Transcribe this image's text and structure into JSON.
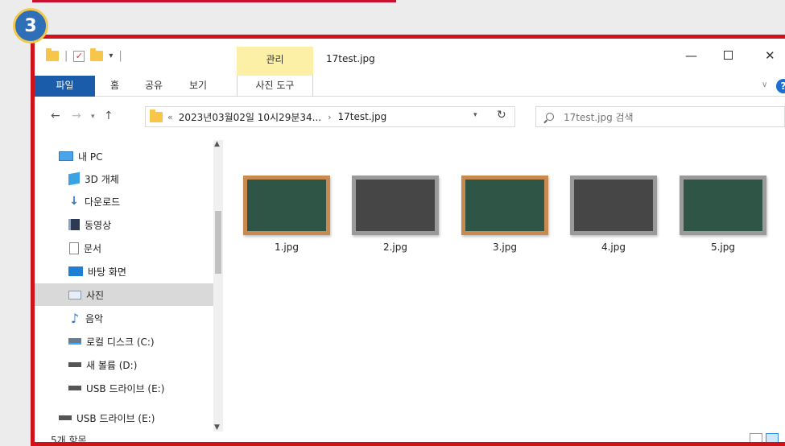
{
  "step_badge": "3",
  "window": {
    "title": "17test.jpg",
    "manage_tab": "관리"
  },
  "ribbon": {
    "tabs": [
      "파일",
      "홈",
      "공유",
      "보기",
      "사진 도구"
    ]
  },
  "address": {
    "overflow": "«",
    "crumbs": [
      "2023년03월02일 10시29분34...",
      "17test.jpg"
    ],
    "arrow": "›",
    "search_placeholder": "17test.jpg 검색"
  },
  "nav_pane": {
    "items": [
      {
        "label": "내 PC",
        "icon": "pc-icon"
      },
      {
        "label": "3D 개체",
        "icon": "3d-objects-icon"
      },
      {
        "label": "다운로드",
        "icon": "download-icon"
      },
      {
        "label": "동영상",
        "icon": "video-icon"
      },
      {
        "label": "문서",
        "icon": "document-icon"
      },
      {
        "label": "바탕 화면",
        "icon": "desktop-icon"
      },
      {
        "label": "사진",
        "icon": "pictures-icon",
        "selected": true
      },
      {
        "label": "음악",
        "icon": "music-icon"
      },
      {
        "label": "로컬 디스크 (C:)",
        "icon": "local-disk-icon"
      },
      {
        "label": "새 볼륨 (D:)",
        "icon": "drive-icon"
      },
      {
        "label": "USB 드라이브 (E:)",
        "icon": "usb-drive-icon"
      },
      {
        "label": "USB 드라이브 (E:)",
        "icon": "usb-drive-icon"
      }
    ]
  },
  "files": [
    {
      "name": "1.jpg",
      "frame": "wood",
      "board": "green"
    },
    {
      "name": "2.jpg",
      "frame": "grey",
      "board": "dark"
    },
    {
      "name": "3.jpg",
      "frame": "wood",
      "board": "green"
    },
    {
      "name": "4.jpg",
      "frame": "grey",
      "board": "dark"
    },
    {
      "name": "5.jpg",
      "frame": "grey",
      "board": "green"
    }
  ],
  "status": {
    "item_count": "5개 항목"
  },
  "colors": {
    "highlight_border": "#d0121b",
    "file_tab": "#1a5ca9",
    "manage_tab": "#fcefa6",
    "badge": "#2f6fb8"
  }
}
